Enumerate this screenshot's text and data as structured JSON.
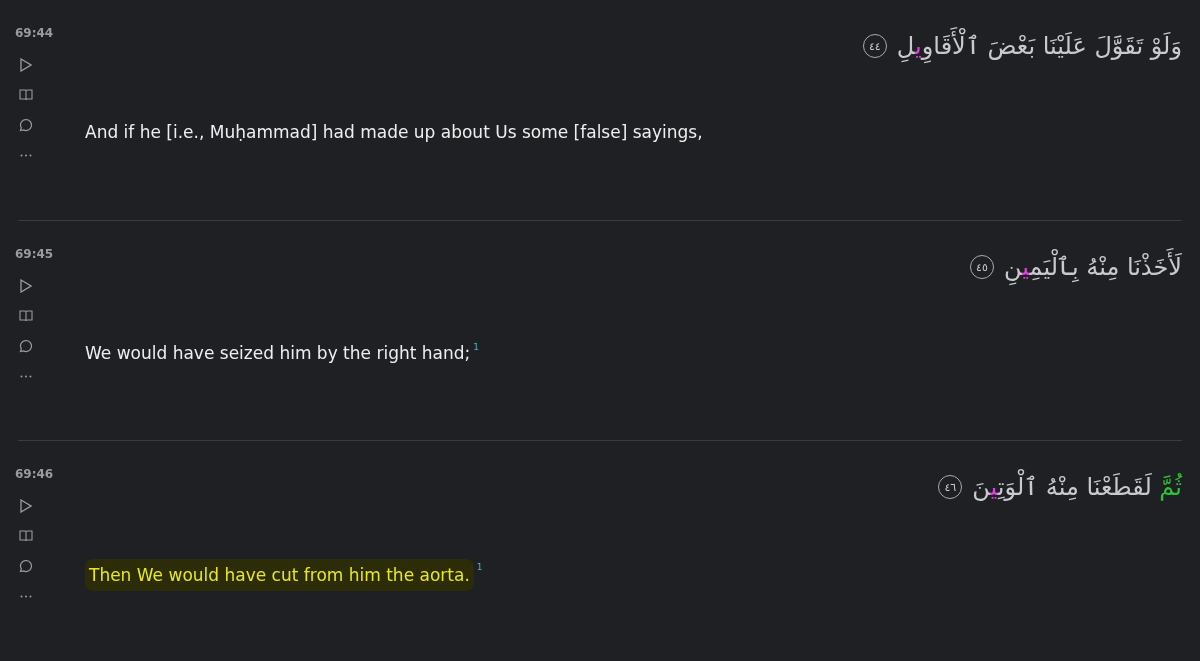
{
  "verses": [
    {
      "key": "69:44",
      "arabic": [
        {
          "text": "وَلَوْ تَقَوَّلَ عَلَيْنَا بَعْضَ ٱلْأَقَاوِ"
        },
        {
          "text": "ي",
          "color": "#e040e0"
        },
        {
          "text": "لِ"
        }
      ],
      "number": "٤٤",
      "translation": "And if he [i.e., Muḥammad] had made up about Us some [false] sayings,",
      "highlighted": false
    },
    {
      "key": "69:45",
      "arabic": [
        {
          "text": "لَأَخَذْنَا مِنْهُ بِٱلْيَمِ"
        },
        {
          "text": "ي",
          "color": "#e040e0"
        },
        {
          "text": "نِ"
        }
      ],
      "number": "٤٥",
      "translation": "We would have seized him by the right hand;",
      "footnote": "1",
      "highlighted": false
    },
    {
      "key": "69:46",
      "arabic": [
        {
          "text": "ثُمَّ",
          "color": "#2fbf3a"
        },
        {
          "text": " لَقَطَعْنَا مِنْهُ ٱلْوَتِ"
        },
        {
          "text": "ي",
          "color": "#e040e0"
        },
        {
          "text": "نَ"
        }
      ],
      "number": "٤٦",
      "translation": "Then We would have cut from him the aorta.",
      "footnote": "1",
      "highlighted": true
    }
  ]
}
